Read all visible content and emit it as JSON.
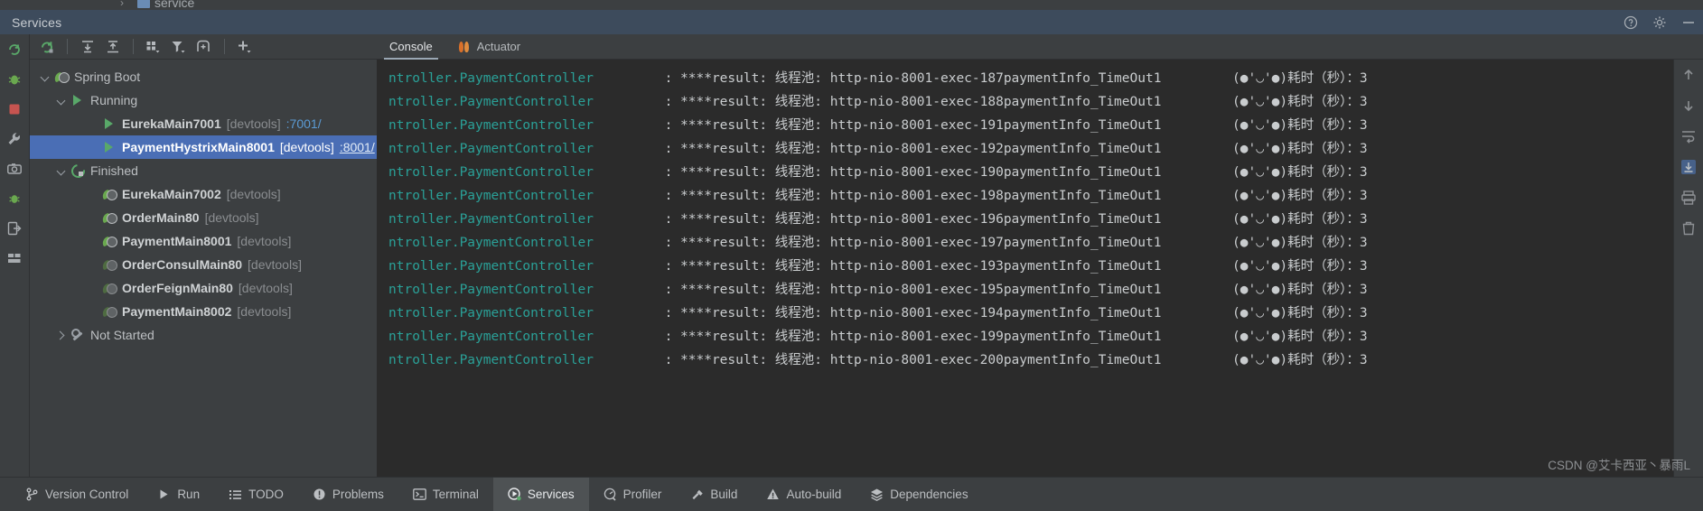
{
  "editor_sliver": {
    "label": "service",
    "chevron": "chevron-right-icon"
  },
  "tool_window": {
    "title": "Services",
    "header_actions": [
      {
        "name": "help-icon",
        "label": "?"
      },
      {
        "name": "settings-gear-icon",
        "label": "gear"
      },
      {
        "name": "hide-window-icon",
        "label": "minimize"
      }
    ]
  },
  "left_strip_icons": [
    "rerun-icon",
    "debug-icon",
    "stop-icon",
    "wrench-icon",
    "camera-icon",
    "thread-dump-icon",
    "exit-icon",
    "layout-icon"
  ],
  "tree_toolbar": [
    {
      "name": "rerun-service-icon",
      "label": "Rerun"
    },
    {
      "name": "expand-all-icon",
      "label": "Expand All"
    },
    {
      "name": "collapse-all-icon",
      "label": "Collapse All"
    },
    {
      "name": "group-by-icon",
      "label": "Group By"
    },
    {
      "name": "filter-icon",
      "label": "Filter"
    },
    {
      "name": "show-configurations-icon",
      "label": "Show Configurations"
    },
    {
      "name": "add-service-icon",
      "label": "Add Service"
    }
  ],
  "tree": {
    "nodes": [
      {
        "indent": 0,
        "chevron": "expanded",
        "icon": "spring-boot-icon",
        "name": "Spring Boot",
        "bold": false,
        "tag": "",
        "link": "",
        "selected": false
      },
      {
        "indent": 1,
        "chevron": "expanded",
        "icon": "run-icon",
        "name": "Running",
        "bold": false,
        "tag": "",
        "link": "",
        "selected": false
      },
      {
        "indent": 2,
        "chevron": "none",
        "icon": "run-icon",
        "name": "EurekaMain7001",
        "bold": true,
        "tag": "[devtools]",
        "link": ":7001/",
        "selected": false
      },
      {
        "indent": 2,
        "chevron": "none",
        "icon": "run-icon",
        "name": "PaymentHystrixMain8001",
        "bold": true,
        "tag": "[devtools]",
        "link": ":8001/",
        "selected": true
      },
      {
        "indent": 1,
        "chevron": "expanded",
        "icon": "rerun-icon",
        "name": "Finished",
        "bold": false,
        "tag": "",
        "link": "",
        "selected": false
      },
      {
        "indent": 2,
        "chevron": "none",
        "icon": "spring-boot-icon",
        "name": "EurekaMain7002",
        "bold": true,
        "tag": "[devtools]",
        "link": "",
        "selected": false
      },
      {
        "indent": 2,
        "chevron": "none",
        "icon": "spring-boot-icon",
        "name": "OrderMain80",
        "bold": true,
        "tag": "[devtools]",
        "link": "",
        "selected": false
      },
      {
        "indent": 2,
        "chevron": "none",
        "icon": "spring-boot-icon",
        "name": "PaymentMain8001",
        "bold": true,
        "tag": "[devtools]",
        "link": "",
        "selected": false
      },
      {
        "indent": 2,
        "chevron": "none",
        "icon": "spring-boot-icon-dim",
        "name": "OrderConsulMain80",
        "bold": true,
        "tag": "[devtools]",
        "link": "",
        "selected": false
      },
      {
        "indent": 2,
        "chevron": "none",
        "icon": "spring-boot-icon-dim",
        "name": "OrderFeignMain80",
        "bold": true,
        "tag": "[devtools]",
        "link": "",
        "selected": false
      },
      {
        "indent": 2,
        "chevron": "none",
        "icon": "spring-boot-icon-dim",
        "name": "PaymentMain8002",
        "bold": true,
        "tag": "[devtools]",
        "link": "",
        "selected": false
      },
      {
        "indent": 1,
        "chevron": "collapsed",
        "icon": "wrench-icon",
        "name": "Not Started",
        "bold": false,
        "tag": "",
        "link": "",
        "selected": false
      }
    ]
  },
  "console_tabs": [
    {
      "label": "Console",
      "icon": "",
      "active": true
    },
    {
      "label": "Actuator",
      "icon": "actuator-icon",
      "active": false
    }
  ],
  "console": {
    "logger": "ntroller.PaymentController",
    "separator": ":",
    "prefix": "****result:",
    "pool_label": "线程池:",
    "suffix": "paymentInfo_TimeOut1",
    "emoji_text": "(●'◡'●)耗时（秒）：3",
    "lines": [
      {
        "thread": "http-nio-8001-exec-187"
      },
      {
        "thread": "http-nio-8001-exec-188"
      },
      {
        "thread": "http-nio-8001-exec-191"
      },
      {
        "thread": "http-nio-8001-exec-192"
      },
      {
        "thread": "http-nio-8001-exec-190"
      },
      {
        "thread": "http-nio-8001-exec-198"
      },
      {
        "thread": "http-nio-8001-exec-196"
      },
      {
        "thread": "http-nio-8001-exec-197"
      },
      {
        "thread": "http-nio-8001-exec-193"
      },
      {
        "thread": "http-nio-8001-exec-195"
      },
      {
        "thread": "http-nio-8001-exec-194"
      },
      {
        "thread": "http-nio-8001-exec-199"
      },
      {
        "thread": "http-nio-8001-exec-200"
      }
    ]
  },
  "console_gutter_icons": [
    "scroll-up-icon",
    "scroll-down-icon",
    "soft-wrap-icon",
    "scroll-to-end-icon",
    "print-icon",
    "clear-all-icon"
  ],
  "status_bar": [
    {
      "label": "Version Control",
      "icon": "branch-icon",
      "active": false
    },
    {
      "label": "Run",
      "icon": "run-icon",
      "active": false
    },
    {
      "label": "TODO",
      "icon": "todo-list-icon",
      "active": false
    },
    {
      "label": "Problems",
      "icon": "problems-icon",
      "active": false
    },
    {
      "label": "Terminal",
      "icon": "terminal-icon",
      "active": false
    },
    {
      "label": "Services",
      "icon": "services-icon",
      "active": true
    },
    {
      "label": "Profiler",
      "icon": "profiler-icon",
      "active": false
    },
    {
      "label": "Build",
      "icon": "hammer-icon",
      "active": false
    },
    {
      "label": "Auto-build",
      "icon": "warning-icon",
      "active": false
    },
    {
      "label": "Dependencies",
      "icon": "layers-icon",
      "active": false
    }
  ],
  "watermark": "CSDN @艾卡西亚丶暴雨L",
  "colors": {
    "selection": "#4a6eb5",
    "console_bg": "#2b2b2b",
    "panel_bg": "#3c3f41",
    "header_bg": "#3d4b5c",
    "logger_text": "#2aa198",
    "link": "#5b9bd5",
    "green": "#59a869"
  }
}
